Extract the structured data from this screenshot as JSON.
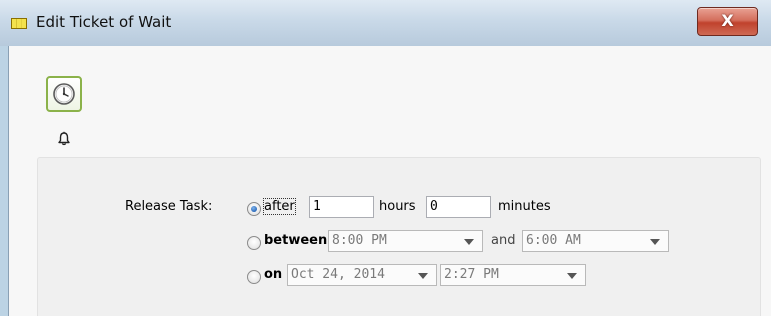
{
  "window": {
    "title": "Edit Ticket of Wait",
    "close_label": "X"
  },
  "toolbar": {
    "icons": [
      "clock-icon",
      "bell-icon"
    ]
  },
  "release": {
    "label": "Release Task:",
    "selected": "after",
    "after": {
      "option_label": "after",
      "hours_value": "1",
      "hours_label": "hours",
      "minutes_value": "0",
      "minutes_label": "minutes"
    },
    "between": {
      "option_label": "between",
      "start_value": "8:00 PM",
      "and_label": "and",
      "end_value": "6:00 AM"
    },
    "on": {
      "option_label": "on",
      "date_value": "Oct 24, 2014",
      "time_value": "2:27 PM"
    }
  },
  "colors": {
    "close_button": "#c0422d",
    "radio_selected": "#1f5fb3",
    "clock_border": "#8bb24a"
  }
}
